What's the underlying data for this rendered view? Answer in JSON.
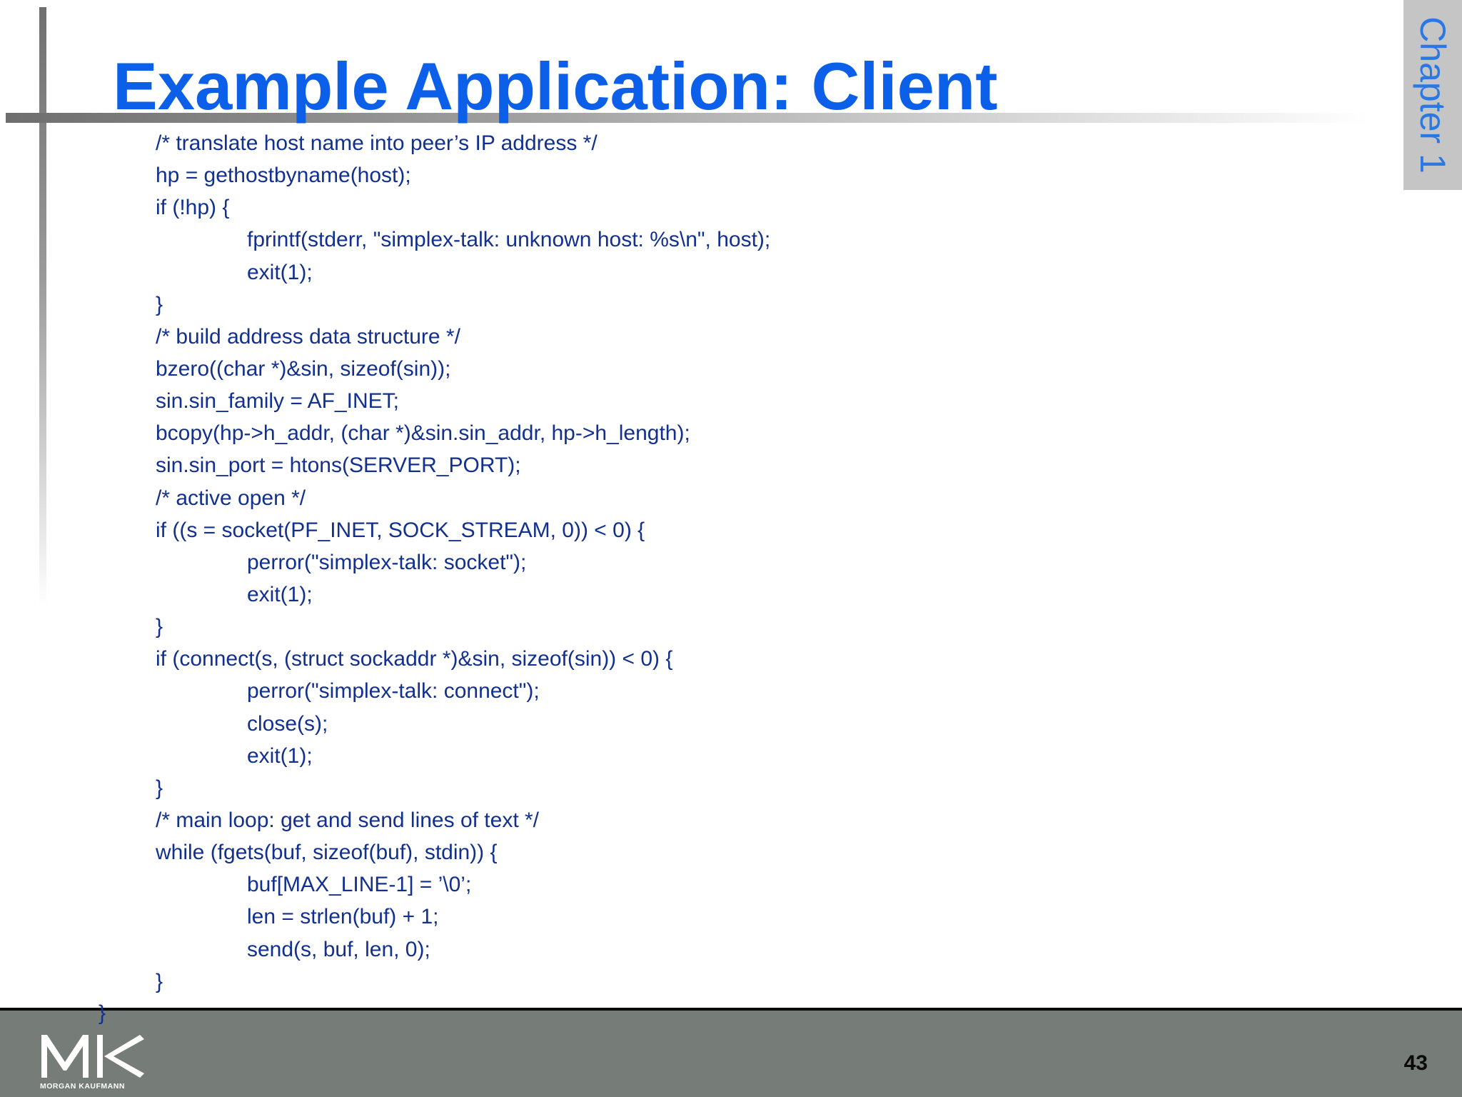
{
  "slide": {
    "title": "Example Application: Client",
    "chapter_tab": "Chapter 1",
    "code_lines": [
      {
        "text": "/* translate host name into peer’s IP address */",
        "indent": 0
      },
      {
        "text": "hp = gethostbyname(host);",
        "indent": 0
      },
      {
        "text": "if (!hp) {",
        "indent": 0
      },
      {
        "text": "fprintf(stderr, \"simplex-talk: unknown host: %s\\n\", host);",
        "indent": 1
      },
      {
        "text": "exit(1);",
        "indent": 1
      },
      {
        "text": "}",
        "indent": 0
      },
      {
        "text": "/* build address data structure */",
        "indent": 0
      },
      {
        "text": "bzero((char *)&sin, sizeof(sin));",
        "indent": 0
      },
      {
        "text": "sin.sin_family = AF_INET;",
        "indent": 0
      },
      {
        "text": "bcopy(hp->h_addr, (char *)&sin.sin_addr, hp->h_length);",
        "indent": 0
      },
      {
        "text": "sin.sin_port = htons(SERVER_PORT);",
        "indent": 0
      },
      {
        "text": "/* active open */",
        "indent": 0
      },
      {
        "text": "if ((s = socket(PF_INET, SOCK_STREAM, 0)) < 0) {",
        "indent": 0
      },
      {
        "text": "perror(\"simplex-talk: socket\");",
        "indent": 1
      },
      {
        "text": "exit(1);",
        "indent": 1
      },
      {
        "text": "}",
        "indent": 0
      },
      {
        "text": "if (connect(s, (struct sockaddr *)&sin, sizeof(sin)) < 0) {",
        "indent": 0
      },
      {
        "text": "perror(\"simplex-talk: connect\");",
        "indent": 1
      },
      {
        "text": "close(s);",
        "indent": 1
      },
      {
        "text": "exit(1);",
        "indent": 1
      },
      {
        "text": "}",
        "indent": 0
      },
      {
        "text": "/* main loop: get and send lines of text */",
        "indent": 0
      },
      {
        "text": "while (fgets(buf, sizeof(buf), stdin)) {",
        "indent": 0
      },
      {
        "text": "buf[MAX_LINE-1] = ’\\0’;",
        "indent": 1
      },
      {
        "text": "len = strlen(buf) + 1;",
        "indent": 1
      },
      {
        "text": "send(s, buf, len, 0);",
        "indent": 1
      },
      {
        "text": "}",
        "indent": 0
      }
    ],
    "closing_brace": "}"
  },
  "footer": {
    "logo_caption": "MORGAN KAUFMANN",
    "page_number": "43"
  },
  "colors": {
    "title": "#0b5fe8",
    "code_text": "#12308f",
    "chapter_text": "#2a78e4",
    "chapter_tab_bg": "#c5c5c5",
    "footer_bg": "#767c77"
  }
}
